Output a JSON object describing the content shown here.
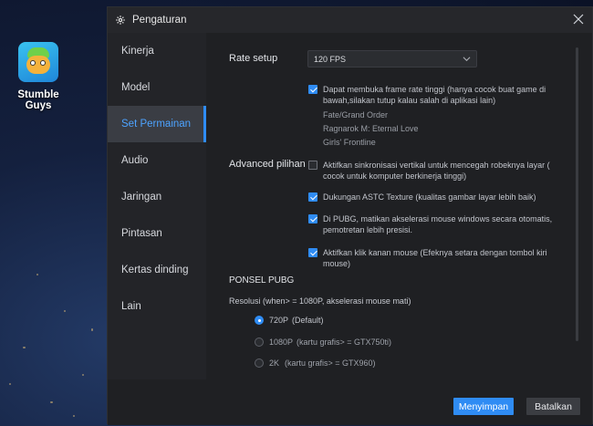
{
  "desktop": {
    "icon_label": "Stumble Guys"
  },
  "dialog": {
    "title": "Pengaturan"
  },
  "sidebar": {
    "items": [
      {
        "label": "Kinerja"
      },
      {
        "label": "Model"
      },
      {
        "label": "Set Permainan"
      },
      {
        "label": "Audio"
      },
      {
        "label": "Jaringan"
      },
      {
        "label": "Pintasan"
      },
      {
        "label": "Kertas dinding"
      },
      {
        "label": "Lain"
      }
    ],
    "active_index": 2
  },
  "settings": {
    "rate_setup_label": "Rate setup",
    "rate_value": "120 FPS",
    "high_fps": {
      "checked": true,
      "text_line1": "Dapat membuka frame rate tinggi  (hanya cocok buat game di",
      "text_line2": "bawah,silakan tutup kalau salah di aplikasi lain)"
    },
    "games": [
      "Fate/Grand Order",
      "Ragnarok M: Eternal Love",
      "Girls' Frontline"
    ],
    "advanced_label": "Advanced pilihan",
    "vsync": {
      "checked": false,
      "text_line1": "Aktifkan sinkronisasi vertikal untuk mencegah robeknya layar   (",
      "text_line2": "cocok untuk komputer berkinerja tinggi)"
    },
    "astc": {
      "checked": true,
      "text": "Dukungan ASTC Texture    (kualitas gambar layar  lebih baik)"
    },
    "pubg_mouse": {
      "checked": true,
      "text_line1": "Di PUBG, matikan akselerasi mouse windows secara otomatis,",
      "text_line2": "pemotretan lebih presisi."
    },
    "right_click": {
      "checked": true,
      "text_line1": "Aktifkan klik kanan mouse (Efeknya setara dengan tombol kiri",
      "text_line2": "mouse)"
    },
    "pubg_section_title": "PONSEL PUBG",
    "resolution_label": "Resolusi   (when> = 1080P, akselerasi mouse mati)",
    "resolutions": [
      {
        "res": "720P",
        "note": "(Default)",
        "selected": true
      },
      {
        "res": "1080P",
        "note": "(kartu grafis> = GTX750ti)",
        "selected": false
      },
      {
        "res": "2K",
        "note": "(kartu grafis> = GTX960)",
        "selected": false
      }
    ]
  },
  "footer": {
    "save_label": "Menyimpan",
    "cancel_label": "Batalkan"
  },
  "colors": {
    "accent": "#2f8cf4",
    "active_nav_text": "#4da3ff",
    "dialog_bg": "#1f2023"
  }
}
